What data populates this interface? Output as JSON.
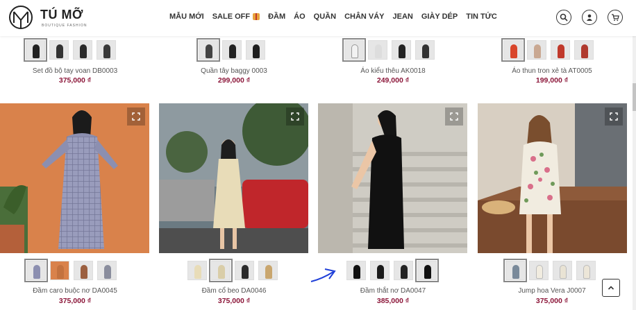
{
  "brand": {
    "name": "TÚ MỠ",
    "tagline": "BOUTIQUE FASHION"
  },
  "nav": [
    {
      "label": "MẪU MỚI"
    },
    {
      "label": "SALE OFF"
    },
    {
      "label": "ĐẦM"
    },
    {
      "label": "ÁO"
    },
    {
      "label": "QUẦN"
    },
    {
      "label": "CHÂN VÁY"
    },
    {
      "label": "JEAN"
    },
    {
      "label": "GIÀY DÉP"
    },
    {
      "label": "TIN TỨC"
    }
  ],
  "top_products": [
    {
      "name": "Set đồ bộ tay voan DB0003",
      "price": "375,000 ₫"
    },
    {
      "name": "Quần tây baggy 0003",
      "price": "299,000 ₫"
    },
    {
      "name": "Áo kiểu thêu AK0018",
      "price": "249,000 ₫"
    },
    {
      "name": "Áo thun tron xẻ tà AT0005",
      "price": "199,000 ₫"
    }
  ],
  "products": [
    {
      "name": "Đầm caro buộc nơ DA0045",
      "price": "375,000 ₫"
    },
    {
      "name": "Đầm cổ beo DA0046",
      "price": "375,000 ₫"
    },
    {
      "name": "Đầm thắt nơ DA0047",
      "price": "385,000 ₫"
    },
    {
      "name": "Jump hoa Vera J0007",
      "price": "375,000 ₫"
    }
  ],
  "colors": {
    "price": "#8b1538",
    "accent": "#1f3fd8"
  }
}
